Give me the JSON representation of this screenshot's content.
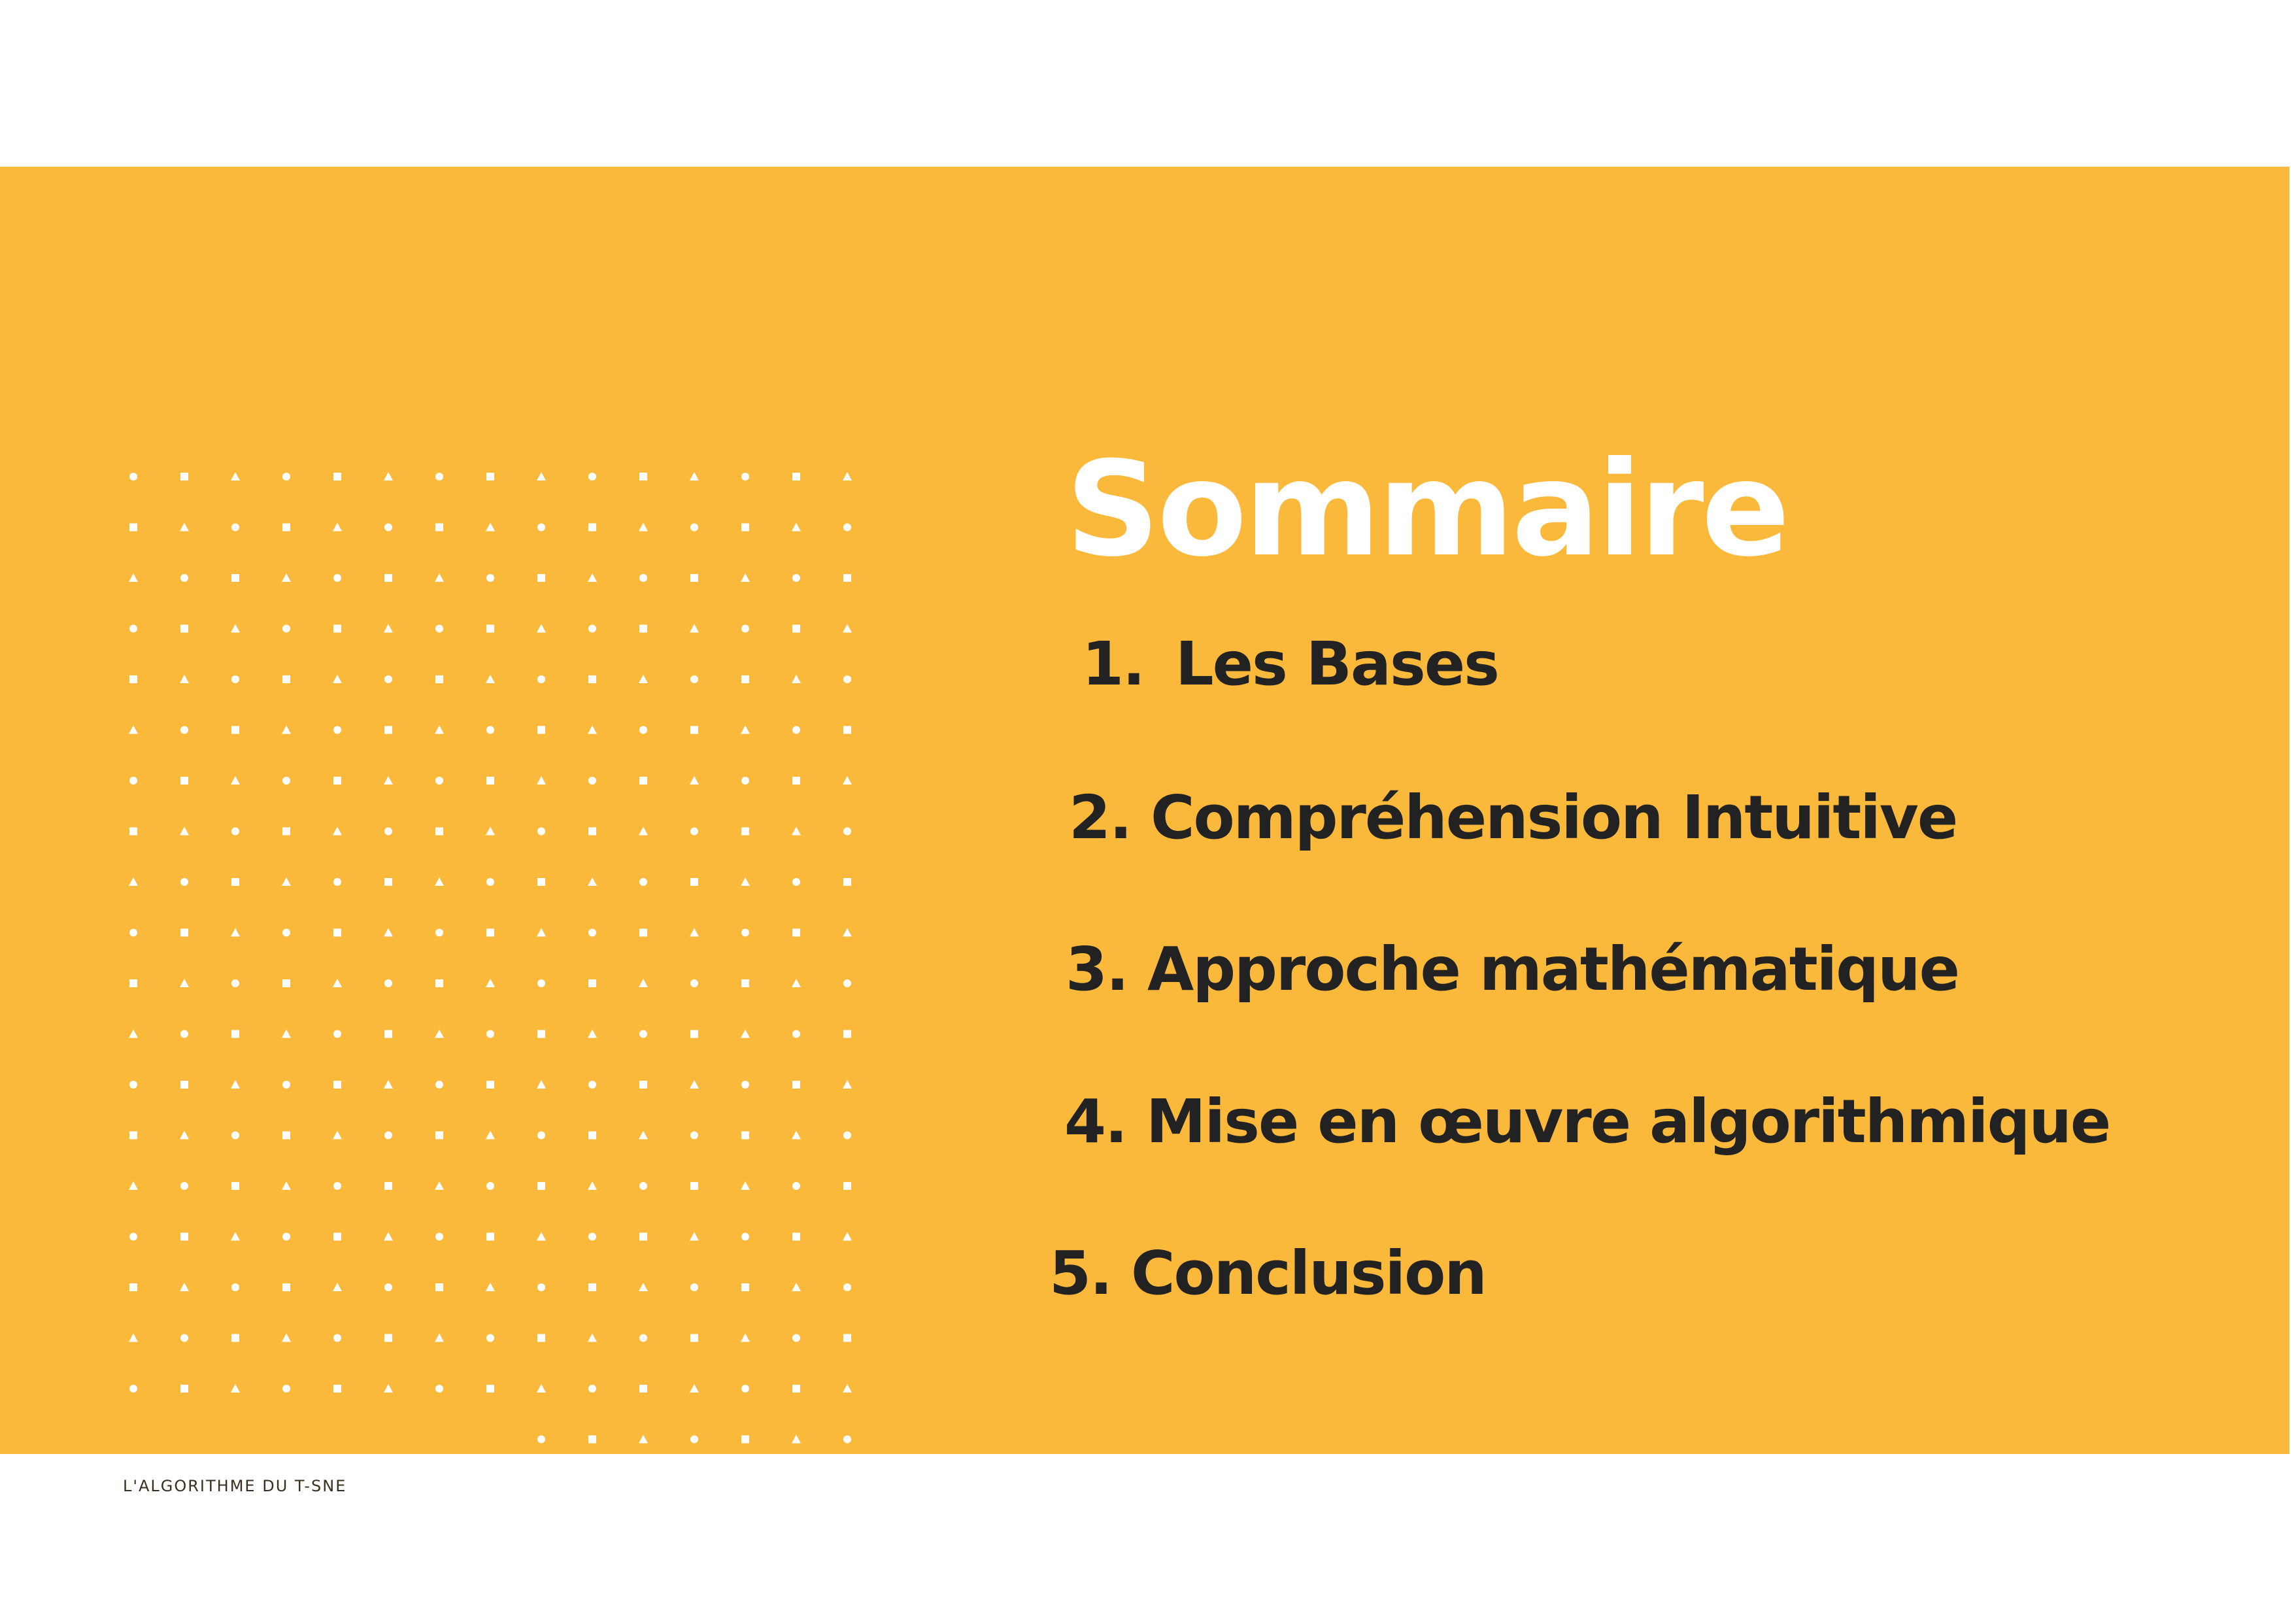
{
  "colors": {
    "background": "#ffffff",
    "slide": "#FBB93C",
    "title": "#ffffff",
    "items": "#222222",
    "pattern": "#ffffff"
  },
  "slide": {
    "title": "Sommaire",
    "toc": [
      {
        "number": "1.",
        "label": "Les Bases"
      },
      {
        "number": "2.",
        "label": "Compréhension Intuitive"
      },
      {
        "number": "3.",
        "label": "Approche mathématique"
      },
      {
        "number": "4.",
        "label": "Mise en œuvre algorithmique"
      },
      {
        "number": "5.",
        "label": "Conclusion"
      }
    ],
    "footer": "L'ALGORITHME DU T-SNE"
  },
  "decor": {
    "pattern_shapes": [
      "circle",
      "square",
      "triangle"
    ]
  }
}
